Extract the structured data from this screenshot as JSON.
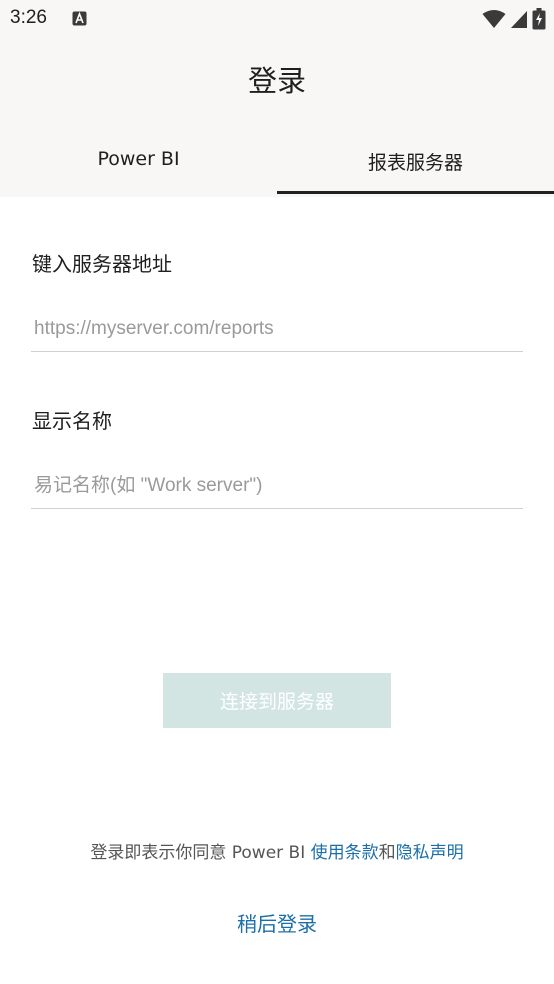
{
  "status_bar": {
    "time": "3:26",
    "icons": [
      "a-notification-icon",
      "wifi-icon",
      "signal-icon",
      "battery-charging-icon"
    ]
  },
  "header": {
    "title": "登录"
  },
  "tabs": [
    {
      "label": "Power BI",
      "active": false
    },
    {
      "label": "报表服务器",
      "active": true
    }
  ],
  "form": {
    "server": {
      "label": "键入服务器地址",
      "placeholder": "https://myserver.com/reports",
      "value": ""
    },
    "display_name": {
      "label": "显示名称",
      "placeholder": "易记名称(如 \"Work server\")",
      "value": ""
    },
    "connect_label": "连接到服务器"
  },
  "footer": {
    "terms_prefix": "登录即表示你同意 Power BI ",
    "terms_link": "使用条款",
    "terms_and": "和",
    "privacy_link": "隐私声明",
    "later_label": "稍后登录"
  },
  "colors": {
    "accent": "#1b6fa8",
    "disabled_button": "#d2e5e3",
    "header_bg": "#f8f7f5"
  }
}
